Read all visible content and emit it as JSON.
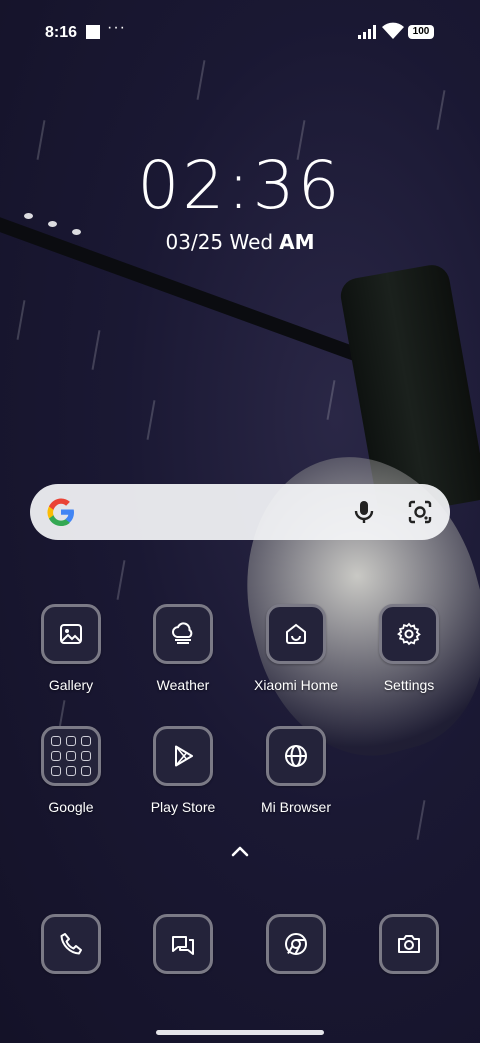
{
  "status_bar": {
    "time": "8:16",
    "more_dots": "···",
    "battery": "100",
    "icons": [
      "square-notification-icon",
      "signal-icon",
      "wifi-icon",
      "battery-icon"
    ]
  },
  "clock": {
    "time": "02:36",
    "date": "03/25 Wed",
    "ampm": "AM"
  },
  "search_bar": {
    "icons": [
      "google-g-icon",
      "mic-icon",
      "google-lens-icon"
    ]
  },
  "apps": [
    {
      "label": "Gallery",
      "icon": "gallery-icon"
    },
    {
      "label": "Weather",
      "icon": "weather-icon"
    },
    {
      "label": "Xiaomi Home",
      "icon": "xiaomi-home-icon"
    },
    {
      "label": "Settings",
      "icon": "settings-icon"
    },
    {
      "label": "Google",
      "icon": "google-folder-icon"
    },
    {
      "label": "Play Store",
      "icon": "play-store-icon"
    },
    {
      "label": "Mi Browser",
      "icon": "mi-browser-icon"
    }
  ],
  "dock": [
    {
      "icon": "phone-icon"
    },
    {
      "icon": "messages-icon"
    },
    {
      "icon": "chrome-icon"
    },
    {
      "icon": "camera-icon"
    }
  ],
  "colors": {
    "icon_background": "#24233a",
    "icon_border": "#7b7a86",
    "search_background": "#f5f6f8"
  }
}
